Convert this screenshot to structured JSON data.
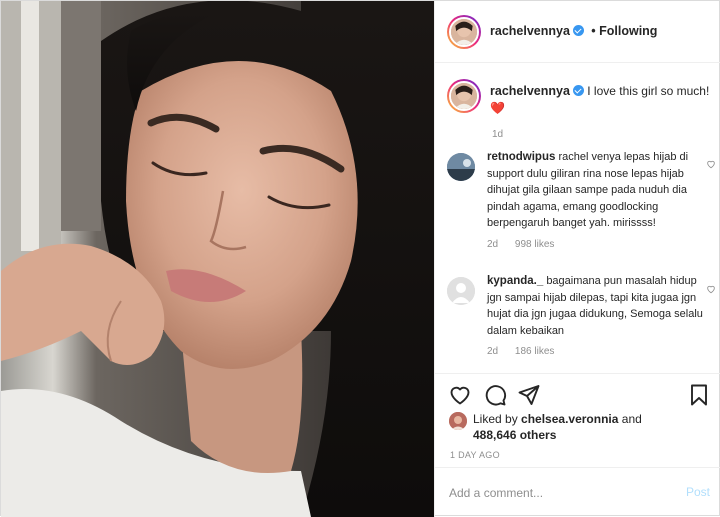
{
  "post": {
    "author": "rachelvennya",
    "follow_label": "• Following",
    "caption_text": "I love this girl so much!",
    "caption_emoji": "❤️",
    "caption_age": "1d"
  },
  "comments": [
    {
      "user": "retnodwipus",
      "text": "rachel venya lepas hijab di support dulu giliran rina nose lepas hijab dihujat gila gilaan sampe pada nuduh dia pindah agama, emang goodlocking berpengaruh banget yah. mirissss!",
      "age": "2d",
      "likes": "998 likes"
    },
    {
      "user": "kypanda._",
      "text": "bagaimana pun masalah hidup jgn sampai hijab dilepas, tapi kita  jugaa jgn hujat dia jgn jugaa didukung, Semoga selalu  dalam kebaikan",
      "age": "2d",
      "likes": "186 likes"
    }
  ],
  "likes": {
    "prefix": "Liked by",
    "user": "chelsea.veronnia",
    "conj": "and",
    "count": "488,646 others"
  },
  "date": "1 DAY AGO",
  "add_comment": {
    "placeholder": "Add a comment...",
    "post_label": "Post"
  },
  "icons": [
    "heart-icon",
    "comment-icon",
    "share-icon",
    "bookmark-icon",
    "verified-icon"
  ],
  "colors": {
    "accent": "#3897f0",
    "post_disabled": "#b2dffc",
    "heart_red": "#e0152c"
  }
}
